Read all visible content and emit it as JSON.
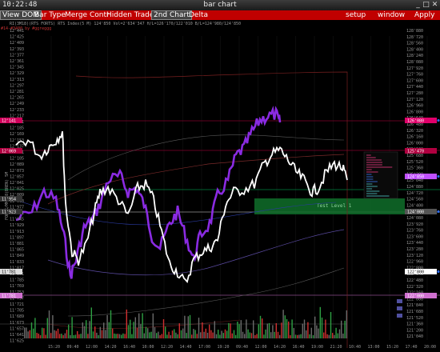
{
  "window": {
    "title": "bar chart",
    "clock": "10:22:48"
  },
  "menu": {
    "items": [
      "View DOM",
      "Bar Type",
      "Merge Contr",
      "Hidden Trades",
      "2nd Chart",
      "Delta"
    ],
    "right": [
      "setup",
      "window",
      "Apply"
    ]
  },
  "chart": {
    "info_line": "RI(3M18)(RTS FORTS) RTS Index(5 M) 124'850 Vol=2'634'347 H/L=126'170/122'010 B/L=124'980/124'850",
    "info_line2": "#14-#3400 by #ggreggg",
    "vertical_label": "FOREX/MMR18(BREN) 5M",
    "left_axis": [
      "12'441",
      "12'425",
      "12'409",
      "12'393",
      "12'377",
      "12'361",
      "12'345",
      "12'329",
      "12'313",
      "12'297",
      "12'281",
      "12'265",
      "12'249",
      "12'233",
      "12'217",
      "12'201",
      "12'185",
      "12'169",
      "12'153",
      "12'137",
      "12'121",
      "12'105",
      "12'089",
      "12'073",
      "12'057",
      "12'041",
      "12'025",
      "12'009",
      "11'993",
      "11'977",
      "11'961",
      "11'945",
      "11'929",
      "11'913",
      "11'897",
      "11'881",
      "11'865",
      "11'849",
      "11'833",
      "11'817",
      "11'801",
      "11'785",
      "11'769",
      "11'753",
      "11'737",
      "11'721",
      "11'705",
      "11'689",
      "11'673",
      "11'657",
      "11'641",
      "11'625"
    ],
    "right_axis": [
      "128'880",
      "128'720",
      "128'560",
      "128'400",
      "128'240",
      "128'080",
      "127'920",
      "127'760",
      "127'600",
      "127'440",
      "127'280",
      "127'120",
      "126'960",
      "126'800",
      "126'640",
      "126'480",
      "126'320",
      "126'160",
      "126'000",
      "125'840",
      "125'680",
      "125'520",
      "125'360",
      "125'200",
      "125'040",
      "124'880",
      "124'720",
      "124'560",
      "124'400",
      "124'240",
      "124'080",
      "123'920",
      "123'760",
      "123'600",
      "123'440",
      "123'280",
      "123'120",
      "122'960",
      "122'800",
      "122'640",
      "122'480",
      "122'320",
      "122'160",
      "122'000",
      "121'840",
      "121'680",
      "121'520",
      "121'360",
      "121'200",
      "121'040"
    ],
    "left_tags": [
      "12'141",
      "12'069",
      "11'954",
      "11'923",
      "11'781",
      "11'781"
    ],
    "right_tags": [
      "126'080",
      "125'470",
      "124'850",
      "124'000",
      "122'800",
      "122'000"
    ],
    "time_axis": [
      "15:20",
      "09:40",
      "12:00",
      "14:20",
      "16:40",
      "10:00",
      "12:20",
      "14:40",
      "17:00",
      "19:20",
      "09:40",
      "12:00",
      "14:20",
      "16:40",
      "19:00",
      "21:20",
      "10:40",
      "13:00",
      "15:20",
      "17:40",
      "20:00"
    ],
    "annotation": "Test Level 1",
    "colors": {
      "menu": "#c00000",
      "series1": "#8a2be2",
      "series2": "#ffffff",
      "level": "#0f6e2a"
    }
  }
}
